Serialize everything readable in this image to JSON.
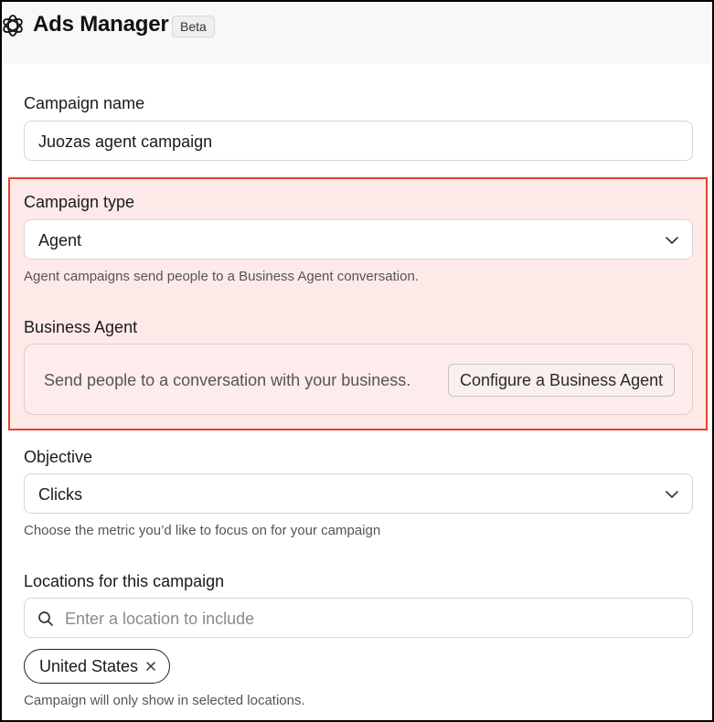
{
  "header": {
    "app_title": "Ads Manager",
    "badge": "Beta",
    "logo_icon": "openai-logo-icon"
  },
  "campaign_name": {
    "label": "Campaign name",
    "value": "Juozas agent campaign"
  },
  "campaign_type": {
    "label": "Campaign type",
    "value": "Agent",
    "help": "Agent campaigns send people to a Business Agent conversation."
  },
  "business_agent": {
    "label": "Business Agent",
    "description": "Send people to a conversation with your business.",
    "button": "Configure a Business Agent"
  },
  "objective": {
    "label": "Objective",
    "value": "Clicks",
    "help": "Choose the metric you’d like to focus on for your campaign"
  },
  "locations": {
    "label": "Locations for this campaign",
    "placeholder": "Enter a location to include",
    "selected": [
      "United States"
    ],
    "help": "Campaign will only show in selected locations."
  },
  "colors": {
    "highlight_border": "#e0452f",
    "highlight_fill": "#fde9e8",
    "header_bg": "#f8f8f8"
  }
}
